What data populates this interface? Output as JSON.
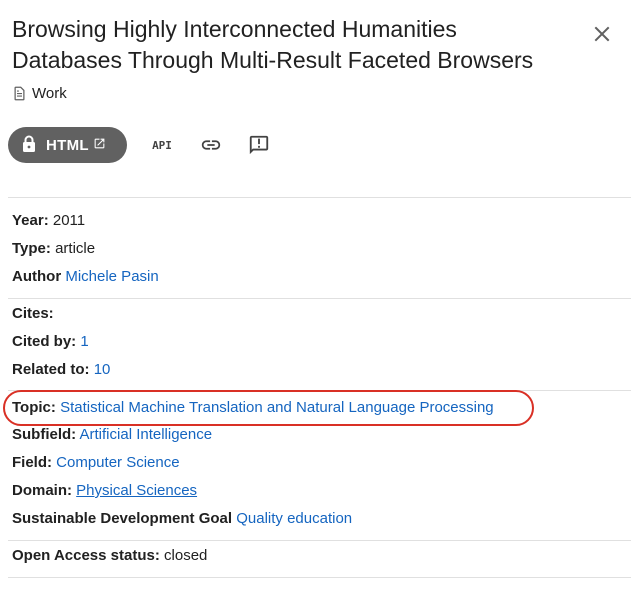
{
  "header": {
    "title": "Browsing Highly Interconnected Humanities Databases Through Multi-Result Faceted Browsers",
    "type_label": "Work"
  },
  "toolbar": {
    "html_label": "HTML",
    "api_label": "API"
  },
  "details": {
    "year_key": "Year:",
    "year_value": "2011",
    "type_key": "Type:",
    "type_value": "article",
    "author_key": "Author",
    "author_value": "Michele Pasin"
  },
  "citations": {
    "cites_key": "Cites:",
    "cited_by_key": "Cited by:",
    "cited_by_value": "1",
    "related_key": "Related to:",
    "related_value": "10"
  },
  "classification": {
    "topic_key": "Topic:",
    "topic_value": "Statistical Machine Translation and Natural Language Processing",
    "subfield_key": "Subfield:",
    "subfield_value": "Artificial Intelligence",
    "field_key": "Field:",
    "field_value": "Computer Science",
    "domain_key": "Domain:",
    "domain_value": "Physical Sciences",
    "sdg_key": "Sustainable Development Goal",
    "sdg_value": "Quality education"
  },
  "access": {
    "key": "Open Access status:",
    "value": "closed"
  },
  "colors": {
    "link": "#1565c0",
    "highlight": "#d93025",
    "button": "#616161"
  },
  "icons": [
    "close-icon",
    "document-icon",
    "lock-icon",
    "open-in-new-icon",
    "link-icon",
    "feedback-icon"
  ]
}
